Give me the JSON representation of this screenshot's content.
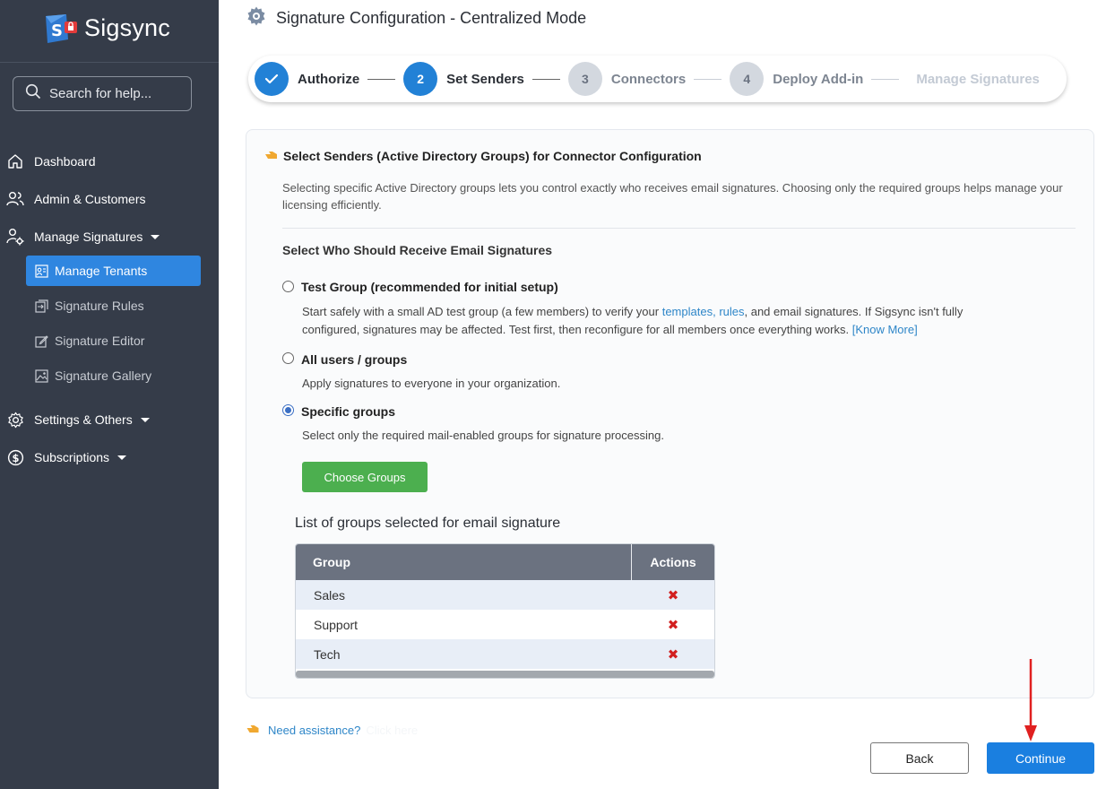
{
  "app": {
    "name": "Sigsync"
  },
  "search": {
    "placeholder": "Search for help..."
  },
  "sidebar": {
    "items": [
      {
        "label": "Dashboard",
        "icon": "home-icon"
      },
      {
        "label": "Admin & Customers",
        "icon": "users-icon"
      },
      {
        "label": "Manage Signatures",
        "icon": "user-gear-icon"
      },
      {
        "label": "Settings & Others",
        "icon": "gear-icon"
      },
      {
        "label": "Subscriptions",
        "icon": "dollar-icon"
      }
    ],
    "sub_items": [
      {
        "label": "Manage Tenants",
        "icon": "tenants-icon",
        "active": true
      },
      {
        "label": "Signature Rules",
        "icon": "rules-icon"
      },
      {
        "label": "Signature Editor",
        "icon": "edit-icon"
      },
      {
        "label": "Signature Gallery",
        "icon": "gallery-icon"
      }
    ]
  },
  "header": {
    "title": "Signature Configuration - Centralized Mode"
  },
  "stepper": {
    "steps": [
      {
        "number": "✓",
        "label": "Authorize",
        "state": "done"
      },
      {
        "number": "2",
        "label": "Set Senders",
        "state": "current"
      },
      {
        "number": "3",
        "label": "Connectors",
        "state": "pending"
      },
      {
        "number": "4",
        "label": "Deploy Add-in",
        "state": "pending"
      },
      {
        "number": "",
        "label": "Manage Signatures",
        "state": "future"
      }
    ]
  },
  "section": {
    "title": "Select Senders (Active Directory Groups) for Connector Configuration",
    "description": "Selecting specific Active Directory groups lets you control exactly who receives email signatures. Choosing only the required groups helps manage your licensing efficiently.",
    "who_title": "Select Who Should Receive Email Signatures"
  },
  "options": {
    "test_group": {
      "title": "Test Group (recommended for initial setup)",
      "desc_1": "Start safely with a small AD test group (a few members) to verify your ",
      "link_templates": "templates",
      "comma": ", ",
      "link_rules": "rules",
      "desc_2": ", and email signatures. If Sigsync isn't fully",
      "desc_3": "configured, signatures may be affected. Test first, then reconfigure for all members once everything works. ",
      "link_know_more": "[Know More]",
      "checked": false
    },
    "all_users": {
      "title": "All users / groups",
      "desc": "Apply signatures to everyone in your organization.",
      "checked": false
    },
    "specific": {
      "title": "Specific groups",
      "desc": "Select only the required mail-enabled groups for signature processing.",
      "checked": true
    }
  },
  "choose_button": "Choose Groups",
  "groups": {
    "title": "List of groups selected for email signature",
    "columns": [
      "Group",
      "Actions"
    ],
    "rows": [
      {
        "group": "Sales",
        "action": "✖"
      },
      {
        "group": "Support",
        "action": "✖"
      },
      {
        "group": "Tech",
        "action": "✖"
      }
    ]
  },
  "assist": {
    "link": "Need assistance?",
    "faint": "Click here"
  },
  "buttons": {
    "back": "Back",
    "continue": "Continue"
  },
  "colors": {
    "sidebar": "#353c49",
    "accent": "#2281d6",
    "green": "#4caf4f",
    "annotation_arrow": "#e02020"
  }
}
